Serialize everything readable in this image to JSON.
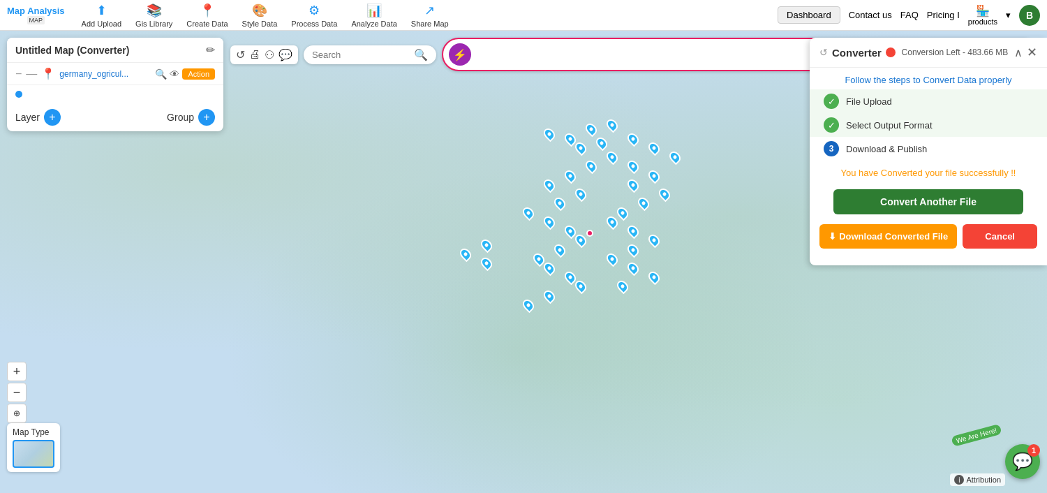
{
  "nav": {
    "brand_title": "Map Analysis",
    "brand_sub": "MAP",
    "items": [
      {
        "label": "Add Upload",
        "icon": "⬆"
      },
      {
        "label": "Gis Library",
        "icon": "📚"
      },
      {
        "label": "Create Data",
        "icon": "📍"
      },
      {
        "label": "Style Data",
        "icon": "🎨"
      },
      {
        "label": "Process Data",
        "icon": "⚙"
      },
      {
        "label": "Analyze Data",
        "icon": "📊"
      },
      {
        "label": "Share Map",
        "icon": "↗"
      }
    ],
    "dashboard": "Dashboard",
    "contact": "Contact us",
    "faq": "FAQ",
    "pricing": "Pricing I",
    "products": "products",
    "avatar": "B"
  },
  "left_panel": {
    "title": "Untitled Map (Converter)",
    "layer_name": "germany_ogricul...",
    "action_btn": "Action",
    "layer_label": "Layer",
    "group_label": "Group"
  },
  "search": {
    "placeholder": "Search"
  },
  "converter_input": {
    "placeholder": ""
  },
  "right_panel": {
    "title": "Converter",
    "conversion_left": "Conversion Left - 483.66 MB",
    "subtitle": "Follow the steps to Convert Data properly",
    "steps": [
      {
        "num": "✓",
        "label": "File Upload",
        "type": "green"
      },
      {
        "num": "✓",
        "label": "Select Output Format",
        "type": "green"
      },
      {
        "num": "3",
        "label": "Download & Publish",
        "type": "num"
      }
    ],
    "success_msg": "You have Converted your file successfully !!",
    "convert_another": "Convert Another File",
    "download_btn": "Download Converted File",
    "cancel_btn": "Cancel"
  },
  "map_type": {
    "label": "Map Type"
  },
  "attribution": {
    "text": "Attribution"
  },
  "chat": {
    "badge": "1",
    "we_are_here": "We Are Here!"
  },
  "zoom": {
    "plus": "+",
    "minus": "−",
    "reset": "⊕"
  }
}
